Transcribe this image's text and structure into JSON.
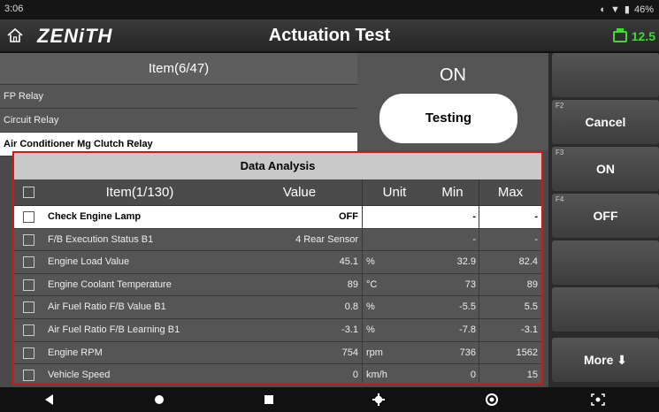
{
  "status_bar": {
    "time": "3:06",
    "battery_percent": "46%"
  },
  "header": {
    "brand": "ZENiTH",
    "title": "Actuation Test",
    "voltage": "12.5",
    "accent_color": "#3ddc2e"
  },
  "item_panel": {
    "header": "Item(6/47)",
    "items": [
      "FP Relay",
      "Circuit Relay",
      "Air Conditioner Mg Clutch Relay"
    ],
    "selected_index": 2
  },
  "status_panel": {
    "state": "ON",
    "button": "Testing"
  },
  "data_analysis": {
    "title": "Data Analysis",
    "columns": {
      "item": "Item(1/130)",
      "value": "Value",
      "unit": "Unit",
      "min": "Min",
      "max": "Max"
    },
    "rows": [
      {
        "item": "Check Engine Lamp",
        "value": "OFF",
        "unit": "",
        "min": "-",
        "max": "-"
      },
      {
        "item": "F/B Execution Status B1",
        "value": "4 Rear Sensor",
        "unit": "",
        "min": "-",
        "max": "-"
      },
      {
        "item": "Engine Load Value",
        "value": "45.1",
        "unit": "%",
        "min": "32.9",
        "max": "82.4"
      },
      {
        "item": "Engine Coolant Temperature",
        "value": "89",
        "unit": "°C",
        "min": "73",
        "max": "89"
      },
      {
        "item": "Air Fuel Ratio F/B Value B1",
        "value": "0.8",
        "unit": "%",
        "min": "-5.5",
        "max": "5.5"
      },
      {
        "item": "Air Fuel Ratio F/B Learning B1",
        "value": "-3.1",
        "unit": "%",
        "min": "-7.8",
        "max": "-3.1"
      },
      {
        "item": "Engine RPM",
        "value": "754",
        "unit": "rpm",
        "min": "736",
        "max": "1562"
      },
      {
        "item": "Vehicle Speed",
        "value": "0",
        "unit": "km/h",
        "min": "0",
        "max": "15"
      }
    ],
    "border_color": "#d01a1a"
  },
  "fkeys": {
    "f2_label": "F2",
    "f2": "Cancel",
    "f3_label": "F3",
    "f3": "ON",
    "f4_label": "F4",
    "f4": "OFF",
    "more": "More ⬇"
  },
  "navbar": {
    "icons": [
      "back-icon",
      "home-icon",
      "recents-icon",
      "settings-icon",
      "chrome-icon",
      "screenshot-icon"
    ]
  }
}
